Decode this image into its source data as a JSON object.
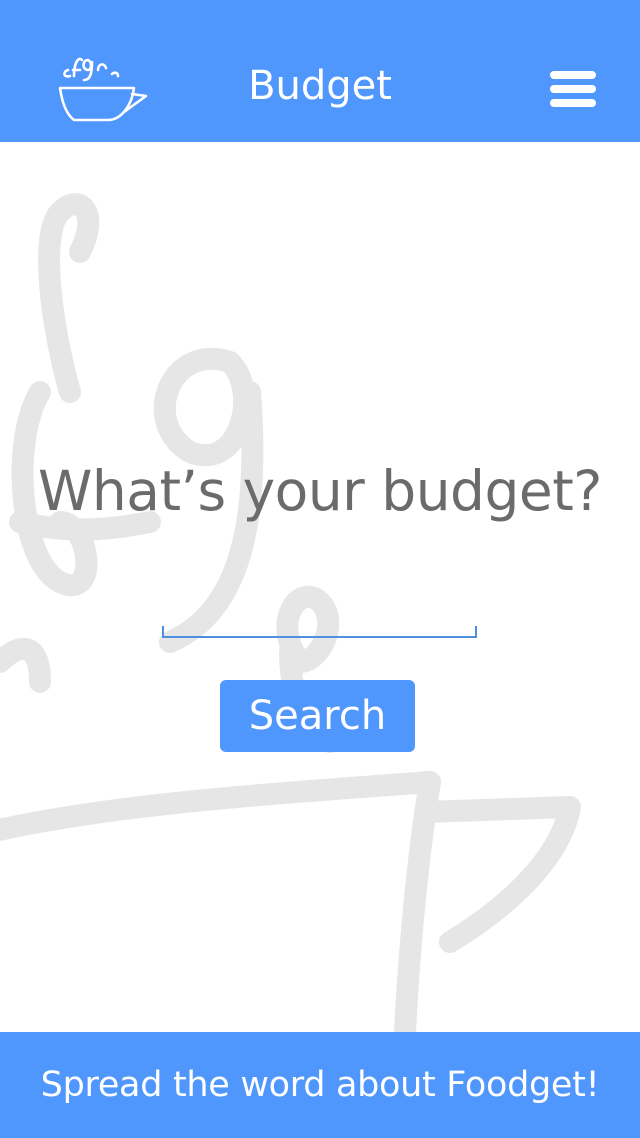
{
  "header": {
    "title": "Budget",
    "logo_icon": "steaming-cup-logo-icon",
    "menu_icon": "hamburger-menu-icon"
  },
  "main": {
    "question": "What’s your budget?",
    "budget_input": {
      "value": "",
      "placeholder": ""
    },
    "search_label": "Search",
    "watermark_icon": "cup-watermark-icon"
  },
  "footer": {
    "share_label": "Spread the word about Foodget!"
  },
  "colors": {
    "brand_blue": "#4f96fd",
    "text_gray": "#6b6b6b",
    "watermark_gray": "#e6e6e6",
    "input_underline": "#4f8fdf"
  }
}
